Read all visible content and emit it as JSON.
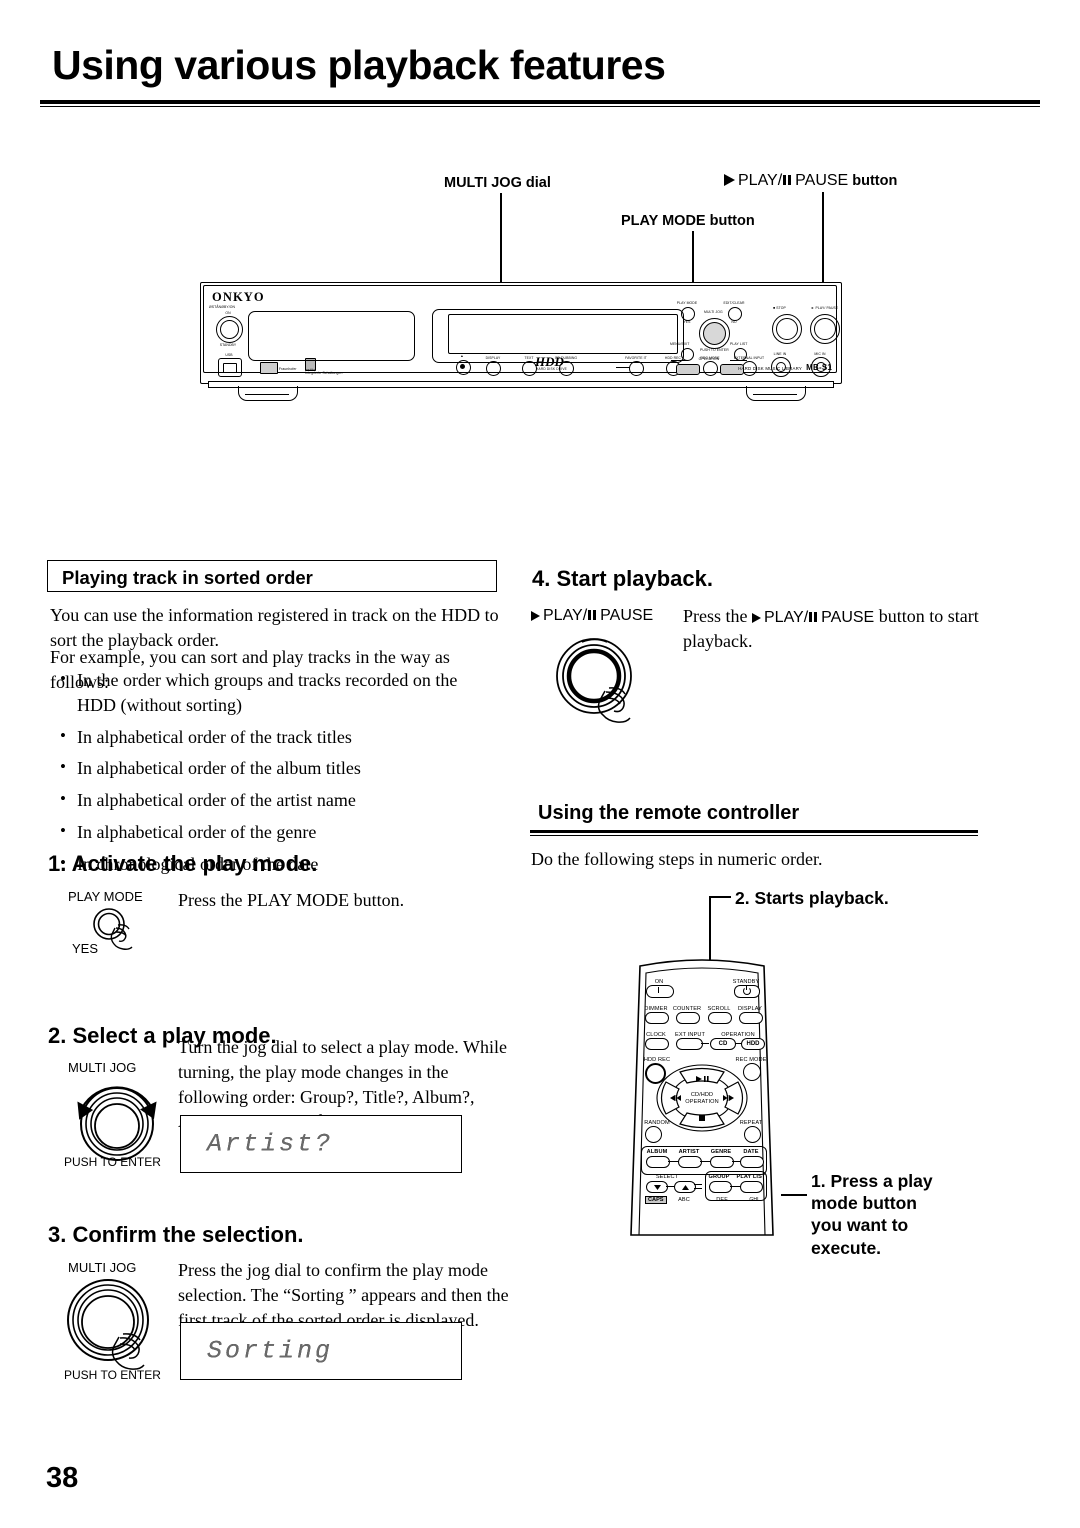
{
  "page": {
    "title": "Using various playback features",
    "number": "38"
  },
  "diagram_callouts": {
    "multi_jog": "MULTI JOG dial",
    "play_mode": "PLAY MODE button",
    "play_pause_pre": "PLAY/",
    "play_pause_post": "PAUSE",
    "play_pause_suffix": " button"
  },
  "unit": {
    "brand": "ONKYO",
    "power_top": "ØSTÅNØBY/ON",
    "power_on": "ON",
    "power_standby": "STANDBY",
    "usb": "USB",
    "copyright1": "Fraunhofer",
    "copyright2": "Institut",
    "copyright3": "Integrierte Schaltungen",
    "hdd_logo": "HDD",
    "hdd_sub": "HARD DISK DRIVE",
    "front_buttons": [
      "DISPLAY",
      "TEXT",
      "CD DUBBING",
      "FAVORITE IT",
      "HDD REC",
      "REC MODE",
      "EXTERNAL INPUT"
    ],
    "play_mode_label": "PLAY MODE",
    "yes_label": "YES",
    "edit_clear_label": "EDIT/CLEAR",
    "no_label": "NO",
    "multi_jog_label": "MULTI JOG",
    "push_to_enter": "PUSH TO ENTER",
    "menu_exit": "MENU/EXIT",
    "play_list": "PLAY LIST",
    "stop": "STOP",
    "play_pause": "PLAY/ PAUSE",
    "operation": "OPERATION",
    "op_cd": "CD",
    "op_hdd": "HDD",
    "line_in": "LINE IN",
    "mic_in": "MIC IN",
    "model_desc": "HARD DISK MUSIC LIBRARY",
    "model_name": "MB-S1"
  },
  "left_column": {
    "box_heading": "Playing track in sorted order",
    "intro": "You can use the information registered in track on the HDD to sort the playback order.",
    "intro2": "For example, you can sort and play tracks in the way as follows:",
    "bullets": [
      "In the order which groups and tracks recorded on the HDD (without sorting)",
      "In alphabetical order of the track titles",
      "In alphabetical order of the album titles",
      "In alphabetical order of the artist name",
      "In alphabetical order of the genre",
      "In chronological order of the date"
    ],
    "step1": {
      "heading": "1. Activate the play mode.",
      "button_label": "PLAY MODE",
      "button_sub": "YES",
      "text": "Press the PLAY MODE button."
    },
    "step2": {
      "heading": "2. Select a play mode.",
      "dial_label": "MULTI JOG",
      "dial_sub": "PUSH TO ENTER",
      "text": "Turn the jog dial to select a play mode. While turning, the play mode changes in the following order: Group?, Title?, Album?, Artist?, Genre?, and Date?.",
      "lcd": "Artist?"
    },
    "step3": {
      "heading": "3. Confirm the selection.",
      "dial_label": "MULTI JOG",
      "dial_sub": "PUSH TO ENTER",
      "text": "Press the jog dial to confirm the play mode selection. The “Sorting ” appears and then the first track of the sorted order is displayed.",
      "lcd": "Sorting"
    }
  },
  "right_column": {
    "step4": {
      "heading": "4. Start playback.",
      "button_label_pre": "PLAY/",
      "button_label_post": "PAUSE",
      "text_a": "Press the ",
      "text_b": "PLAY/",
      "text_c": "PAUSE",
      "text_d": " button to start playback."
    },
    "section": {
      "heading": "Using the remote controller",
      "intro": "Do the following steps in numeric order."
    },
    "callout_2": "2.  Starts playback.",
    "callout_1": "1.  Press a play mode button you want to execute."
  },
  "remote": {
    "on": "ON",
    "standby": "STANDBY",
    "row1": [
      "DIMMER",
      "COUNTER",
      "SCROLL",
      "DISPLAY"
    ],
    "clock": "CLOCK",
    "ext_input": "EXT INPUT",
    "operation": "OPERATION",
    "op_cd": "CD",
    "op_hdd": "HDD",
    "hdd_rec": "HDD REC",
    "rec_mode": "REC MODE",
    "cd_hdd_operation_1": "CD/HDD",
    "cd_hdd_operation_2": "OPERATION",
    "random": "RANDOM",
    "repeat": "REPEAT",
    "mode_row": [
      "ALBUM",
      "ARTIST",
      "GENRE",
      "DATE"
    ],
    "select": "SELECT",
    "group": "GROUP",
    "play_list": "PLAY LIST",
    "caps": "CAPS",
    "abc": "ABC",
    "def": "DEF",
    "ghi": "GHI"
  }
}
